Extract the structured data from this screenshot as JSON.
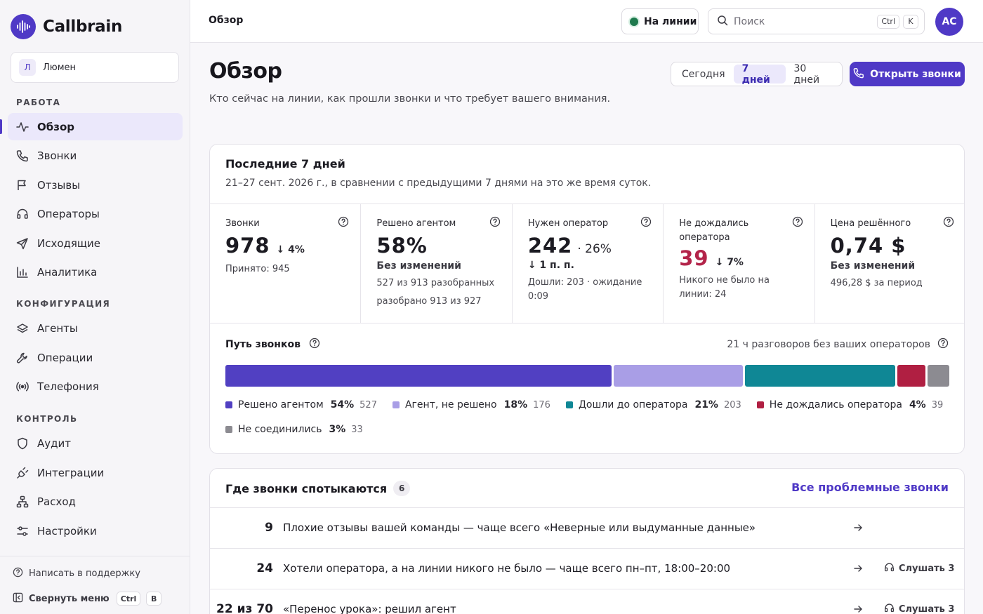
{
  "app": {
    "name": "Callbrain"
  },
  "org": {
    "initial": "Л",
    "name": "Люмен"
  },
  "sidebar": {
    "sections": [
      {
        "title": "РАБОТА"
      },
      {
        "title": "КОНФИГУРАЦИЯ"
      },
      {
        "title": "КОНТРОЛЬ"
      }
    ],
    "items": [
      {
        "label": "Обзор",
        "icon": "activity-icon",
        "active": true
      },
      {
        "label": "Звонки",
        "icon": "phone-icon"
      },
      {
        "label": "Отзывы",
        "icon": "flag-icon"
      },
      {
        "label": "Операторы",
        "icon": "headset-icon"
      },
      {
        "label": "Исходящие",
        "icon": "send-icon"
      },
      {
        "label": "Аналитика",
        "icon": "bar-chart-icon"
      },
      {
        "label": "Агенты",
        "icon": "stack-icon"
      },
      {
        "label": "Операции",
        "icon": "wrench-icon"
      },
      {
        "label": "Телефония",
        "icon": "broadcast-icon"
      },
      {
        "label": "Аудит",
        "icon": "shield-icon"
      },
      {
        "label": "Интеграции",
        "icon": "plug-icon"
      },
      {
        "label": "Расход",
        "icon": "hierarchy-icon"
      },
      {
        "label": "Настройки",
        "icon": "sliders-icon"
      }
    ],
    "support": "Написать в поддержку",
    "collapse": {
      "label": "Свернуть меню",
      "kbd1": "Ctrl",
      "kbd2": "B"
    }
  },
  "topbar": {
    "crumb": "Обзор",
    "status": "На линии",
    "search_placeholder": "Поиск",
    "kbd1": "Ctrl",
    "kbd2": "K",
    "avatar": "АС"
  },
  "header": {
    "title": "Обзор",
    "subtitle": "Кто сейчас на линии, как прошли звонки и что требует вашего внимания.",
    "periods": [
      "Сегодня",
      "7 дней",
      "30 дней"
    ],
    "active_period": "7 дней",
    "open_calls": "Открыть звонки"
  },
  "summary": {
    "title": "Последние 7 дней",
    "subtitle": "21–27 сент. 2026 г., в сравнении с предыдущими 7 днями на это же время суток.",
    "metrics": [
      {
        "label": "Звонки",
        "value": "978",
        "delta": "4%",
        "sub": "Принято: 945"
      },
      {
        "label": "Решено агентом",
        "value": "58%",
        "strong": "Без изменений",
        "line1": "527 из 913 разобранных",
        "line2": "разобрано 913 из 927"
      },
      {
        "label": "Нужен оператор",
        "value": "242",
        "suffix": "· 26%",
        "delta": "1 п. п.",
        "sub": "Дошли: 203 · ожидание 0:09"
      },
      {
        "label": "Не дождались оператора",
        "value": "39",
        "delta": "7%",
        "sub": "Никого не было на линии: 24"
      },
      {
        "label": "Цена решённого",
        "value": "0,74 $",
        "strong": "Без изменений",
        "line1": "496,28 $ за период"
      }
    ],
    "path": {
      "title": "Путь звонков",
      "note": "21 ч разговоров без ваших операторов",
      "segments": [
        {
          "label": "Решено агентом",
          "pct": "54%",
          "count": "527",
          "color": "#5140c2",
          "share": 54
        },
        {
          "label": "Агент, не решено",
          "pct": "18%",
          "count": "176",
          "color": "#a99ee6",
          "share": 18
        },
        {
          "label": "Дошли до оператора",
          "pct": "21%",
          "count": "203",
          "color": "#0f8795",
          "share": 21
        },
        {
          "label": "Не дождались оператора",
          "pct": "4%",
          "count": "39",
          "color": "#b01f42",
          "share": 4
        },
        {
          "label": "Не соединились",
          "pct": "3%",
          "count": "33",
          "color": "#8c8b91",
          "share": 3
        }
      ]
    }
  },
  "issues": {
    "title": "Где звонки спотыкаются",
    "count": "6",
    "link": "Все проблемные звонки",
    "rows": [
      {
        "n": "9",
        "text": "Плохие отзывы вашей команды — чаще всего «Неверные или выдуманные данные»",
        "listen": ""
      },
      {
        "n": "24",
        "text": "Хотели оператора, а на линии никого не было — чаще всего пн–пт, 18:00–20:00",
        "listen": "Слушать 3"
      },
      {
        "n": "22 из 70",
        "text": "«Перенос урока»: решил агент",
        "listen": "Слушать 3"
      }
    ]
  }
}
